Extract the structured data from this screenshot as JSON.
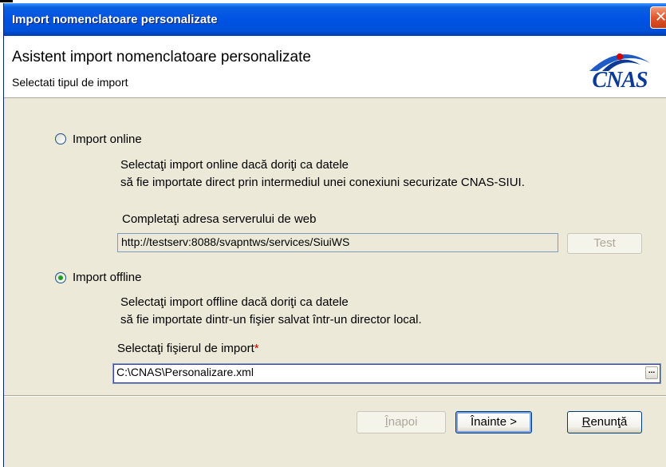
{
  "window": {
    "title": "Import nomenclatoare personalizate",
    "close_glyph": "✕"
  },
  "header": {
    "title": "Asistent import nomenclatoare personalizate",
    "subtitle": "Selectati tipul de import",
    "logo_text": "CNAS"
  },
  "online": {
    "label": "Import online",
    "checked": false,
    "desc_line1": "Selectaţi import online dacă doriţi ca datele",
    "desc_line2": "să fie importate direct prin intermediul unei conexiuni securizate CNAS-SIUI.",
    "server_label": "Completaţi adresa serverului de web",
    "server_value": "http://testserv:8088/svapntws/services/SiuiWS",
    "test_button": "Test"
  },
  "offline": {
    "label": "Import offline",
    "checked": true,
    "desc_line1": "Selectaţi import offline dacă doriţi ca datele",
    "desc_line2": "să fie importate dintr-un fişier salvat într-un director local.",
    "file_label": "Selectaţi fişierul de import",
    "required_mark": "*",
    "file_value": "C:\\CNAS\\Personalizare.xml",
    "browse_label": "..."
  },
  "footer": {
    "back_accel": "Î",
    "back_rest": "napoi",
    "next_label": "Înainte >",
    "cancel_accel": "R",
    "cancel_rest": "enunţă"
  }
}
